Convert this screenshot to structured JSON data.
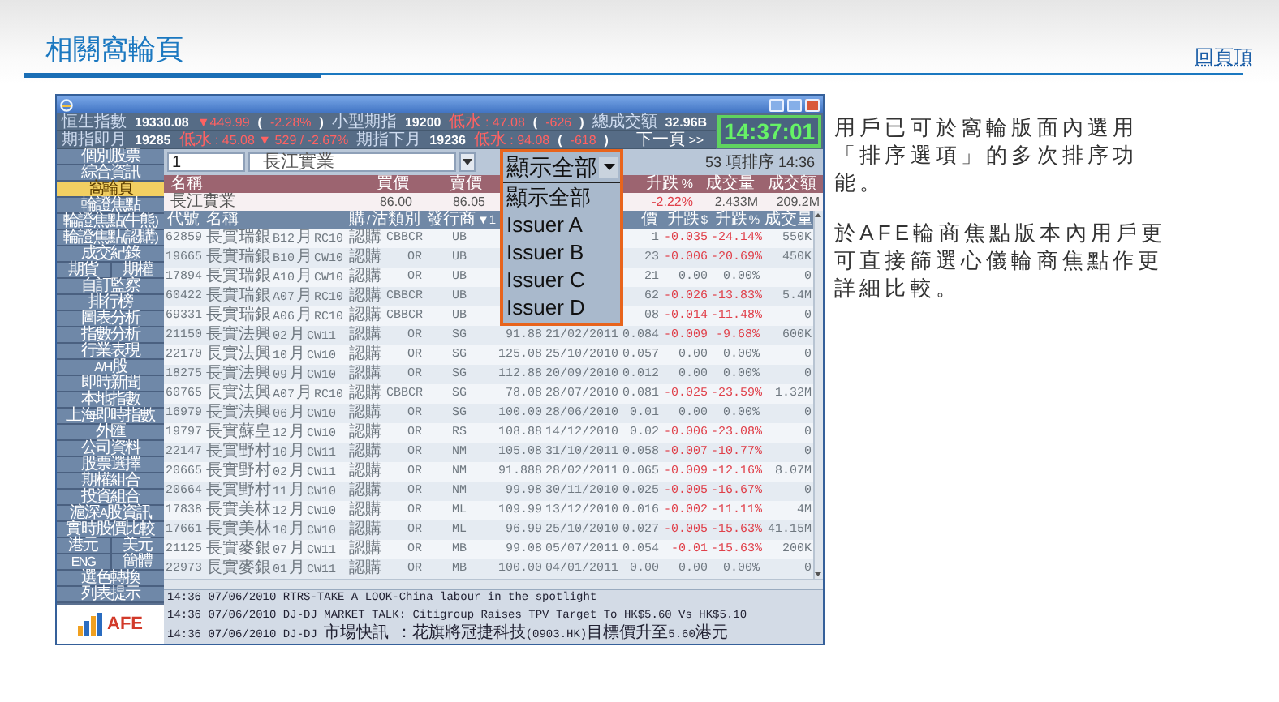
{
  "page": {
    "title": "相關窩輪頁",
    "top_link": "回頁頂"
  },
  "app": {
    "info_rows": [
      [
        {
          "text": "恒生指數",
          "kind": "label"
        },
        {
          "text": "19330.08",
          "kind": "value"
        },
        {
          "text": "▼449.99",
          "kind": "down"
        },
        {
          "text": "(",
          "kind": "value"
        },
        {
          "text": "-2.28%",
          "kind": "down"
        },
        {
          "text": ")",
          "kind": "value"
        },
        {
          "text": "小型期指",
          "kind": "label"
        },
        {
          "text": "19200",
          "kind": "value"
        },
        {
          "text": "低水 : 47.08",
          "kind": "down"
        },
        {
          "text": "(",
          "kind": "value"
        },
        {
          "text": "-626",
          "kind": "down"
        },
        {
          "text": ")",
          "kind": "value"
        },
        {
          "text": "總成交額",
          "kind": "label"
        },
        {
          "text": "32.96B",
          "kind": "value"
        }
      ],
      [
        {
          "text": "期指即月",
          "kind": "label"
        },
        {
          "text": "19285",
          "kind": "value"
        },
        {
          "text": "低水 : 45.08 ▼ 529 / -2.67%",
          "kind": "down"
        },
        {
          "text": "期指下月",
          "kind": "label"
        },
        {
          "text": "19236",
          "kind": "value"
        },
        {
          "text": "低水 : 94.08",
          "kind": "down"
        },
        {
          "text": "(",
          "kind": "value"
        },
        {
          "text": "-618",
          "kind": "down"
        },
        {
          "text": ")",
          "kind": "value"
        },
        {
          "text": "下一頁 >>",
          "kind": "link"
        }
      ]
    ],
    "clock": "14:37:01",
    "sidebar": [
      {
        "kind": "single",
        "label": "個別股票",
        "selected": false
      },
      {
        "kind": "single",
        "label": "綜合資訊",
        "selected": false
      },
      {
        "kind": "single",
        "label": "窩輪頁",
        "selected": true
      },
      {
        "kind": "single",
        "label": "輪證焦點",
        "selected": false
      },
      {
        "kind": "single",
        "label": "輪證焦點(牛熊)",
        "selected": false
      },
      {
        "kind": "single",
        "label": "輪證焦點(認購)",
        "selected": false
      },
      {
        "kind": "single",
        "label": "成交紀錄",
        "selected": false
      },
      {
        "kind": "pair",
        "items": [
          {
            "label": "期貨",
            "selected": false
          },
          {
            "label": "期權",
            "selected": false
          }
        ]
      },
      {
        "kind": "single",
        "label": "自訂監察",
        "selected": false
      },
      {
        "kind": "single",
        "label": "排行榜",
        "selected": false
      },
      {
        "kind": "single",
        "label": "圖表分析",
        "selected": false
      },
      {
        "kind": "single",
        "label": "指數分析",
        "selected": false
      },
      {
        "kind": "single",
        "label": "行業表現",
        "selected": false
      },
      {
        "kind": "single",
        "label": "A/H股",
        "selected": false
      },
      {
        "kind": "single",
        "label": "即時新聞",
        "selected": false
      },
      {
        "kind": "single",
        "label": "本地指數",
        "selected": false
      },
      {
        "kind": "single",
        "label": "上海即時指數",
        "selected": false
      },
      {
        "kind": "single",
        "label": "外匯",
        "selected": false
      },
      {
        "kind": "single",
        "label": "公司資料",
        "selected": false
      },
      {
        "kind": "single",
        "label": "股票選擇",
        "selected": false
      },
      {
        "kind": "single",
        "label": "期權組合",
        "selected": false
      },
      {
        "kind": "single",
        "label": "投資組合",
        "selected": false
      },
      {
        "kind": "single",
        "label": "滬深A股資訊",
        "selected": false
      },
      {
        "kind": "single",
        "label": "實時股價比較",
        "selected": false
      },
      {
        "kind": "pair",
        "items": [
          {
            "label": "港元",
            "selected": false
          },
          {
            "label": "美元",
            "selected": false
          }
        ]
      },
      {
        "kind": "pair",
        "items": [
          {
            "label": "ENG",
            "selected": false
          },
          {
            "label": "簡體",
            "selected": false
          }
        ]
      },
      {
        "kind": "single",
        "label": "選色轉換",
        "selected": false
      },
      {
        "kind": "single",
        "label": "列表提示",
        "selected": false
      }
    ],
    "logo": "AFE",
    "search": {
      "code": "1",
      "name": "長江實業"
    },
    "filter": {
      "value": "顯示全部",
      "options": [
        "顯示全部",
        "Issuer A",
        "Issuer B",
        "Issuer C",
        "Issuer D"
      ]
    },
    "sort_info": "53 項排序 14:36",
    "quote": {
      "columns": [
        "名稱",
        "買價",
        "賣價",
        "升跌%",
        "成交量",
        "成交額"
      ],
      "values": [
        {
          "text": "長江實業",
          "down": false
        },
        {
          "text": "86.00",
          "down": false
        },
        {
          "text": "86.05",
          "down": false
        },
        {
          "text": "-2.22%",
          "down": true
        },
        {
          "text": "2.433M",
          "down": false
        },
        {
          "text": "209.2M",
          "down": false
        }
      ]
    },
    "table": {
      "columns": [
        "代號",
        "名稱",
        "購/沽",
        "類別",
        "發行商▼1",
        "價",
        "升跌$",
        "升跌%",
        "成交量"
      ],
      "rows": [
        {
          "code": "62859",
          "name": "長實瑞銀B12月RC10",
          "cp": "認購",
          "category": "CBBCR",
          "issuer": "UB",
          "price": "1",
          "change": "-0.035",
          "change_pct": "-24.14%",
          "volume": "550K",
          "down": true
        },
        {
          "code": "19665",
          "name": "長實瑞銀B10月CW10",
          "cp": "認購",
          "category": "OR",
          "issuer": "UB",
          "price": "23",
          "change": "-0.006",
          "change_pct": "-20.69%",
          "volume": "450K",
          "down": true
        },
        {
          "code": "17894",
          "name": "長實瑞銀A10月CW10",
          "cp": "認購",
          "category": "OR",
          "issuer": "UB",
          "price": "21",
          "change": "0.00",
          "change_pct": "0.00%",
          "volume": "0",
          "down": false
        },
        {
          "code": "60422",
          "name": "長實瑞銀A07月RC10",
          "cp": "認購",
          "category": "CBBCR",
          "issuer": "UB",
          "price": "62",
          "change": "-0.026",
          "change_pct": "-13.83%",
          "volume": "5.4M",
          "down": true
        },
        {
          "code": "69331",
          "name": "長實瑞銀A06月RC10",
          "cp": "認購",
          "category": "CBBCR",
          "issuer": "UB",
          "price": "08",
          "change": "-0.014",
          "change_pct": "-11.48%",
          "volume": "0",
          "down": true
        },
        {
          "code": "21150",
          "name": "長實法興02月CW11",
          "cp": "認購",
          "category": "OR",
          "issuer": "SG",
          "strike": "91.88",
          "expiry": "21/02/2011",
          "price": "0.084",
          "change": "-0.009",
          "change_pct": "-9.68%",
          "volume": "600K",
          "down": true
        },
        {
          "code": "22170",
          "name": "長實法興10月CW10",
          "cp": "認購",
          "category": "OR",
          "issuer": "SG",
          "strike": "125.08",
          "expiry": "25/10/2010",
          "price": "0.057",
          "change": "0.00",
          "change_pct": "0.00%",
          "volume": "0",
          "down": false
        },
        {
          "code": "18275",
          "name": "長實法興09月CW10",
          "cp": "認購",
          "category": "OR",
          "issuer": "SG",
          "strike": "112.88",
          "expiry": "20/09/2010",
          "price": "0.012",
          "change": "0.00",
          "change_pct": "0.00%",
          "volume": "0",
          "down": false
        },
        {
          "code": "60765",
          "name": "長實法興A07月RC10",
          "cp": "認購",
          "category": "CBBCR",
          "issuer": "SG",
          "strike": "78.08",
          "expiry": "28/07/2010",
          "price": "0.081",
          "change": "-0.025",
          "change_pct": "-23.59%",
          "volume": "1.32M",
          "down": true
        },
        {
          "code": "16979",
          "name": "長實法興06月CW10",
          "cp": "認購",
          "category": "OR",
          "issuer": "SG",
          "strike": "100.00",
          "expiry": "28/06/2010",
          "price": "0.01",
          "change": "0.00",
          "change_pct": "0.00%",
          "volume": "0",
          "down": false
        },
        {
          "code": "19797",
          "name": "長實蘇皇12月CW10",
          "cp": "認購",
          "category": "OR",
          "issuer": "RS",
          "strike": "108.88",
          "expiry": "14/12/2010",
          "price": "0.02",
          "change": "-0.006",
          "change_pct": "-23.08%",
          "volume": "0",
          "down": true
        },
        {
          "code": "22147",
          "name": "長實野村10月CW11",
          "cp": "認購",
          "category": "OR",
          "issuer": "NM",
          "strike": "105.08",
          "expiry": "31/10/2011",
          "price": "0.058",
          "change": "-0.007",
          "change_pct": "-10.77%",
          "volume": "0",
          "down": true
        },
        {
          "code": "20665",
          "name": "長實野村02月CW11",
          "cp": "認購",
          "category": "OR",
          "issuer": "NM",
          "strike": "91.888",
          "expiry": "28/02/2011",
          "price": "0.065",
          "change": "-0.009",
          "change_pct": "-12.16%",
          "volume": "8.07M",
          "down": true
        },
        {
          "code": "20664",
          "name": "長實野村11月CW10",
          "cp": "認購",
          "category": "OR",
          "issuer": "NM",
          "strike": "99.98",
          "expiry": "30/11/2010",
          "price": "0.025",
          "change": "-0.005",
          "change_pct": "-16.67%",
          "volume": "0",
          "down": true
        },
        {
          "code": "17838",
          "name": "長實美林12月CW10",
          "cp": "認購",
          "category": "OR",
          "issuer": "ML",
          "strike": "109.99",
          "expiry": "13/12/2010",
          "price": "0.016",
          "change": "-0.002",
          "change_pct": "-11.11%",
          "volume": "4M",
          "down": true
        },
        {
          "code": "17661",
          "name": "長實美林10月CW10",
          "cp": "認購",
          "category": "OR",
          "issuer": "ML",
          "strike": "96.99",
          "expiry": "25/10/2010",
          "price": "0.027",
          "change": "-0.005",
          "change_pct": "-15.63%",
          "volume": "41.15M",
          "down": true
        },
        {
          "code": "21125",
          "name": "長實麥銀07月CW11",
          "cp": "認購",
          "category": "OR",
          "issuer": "MB",
          "strike": "99.08",
          "expiry": "05/07/2011",
          "price": "0.054",
          "change": "-0.01",
          "change_pct": "-15.63%",
          "volume": "200K",
          "down": true
        },
        {
          "code": "22973",
          "name": "長實麥銀01月CW11",
          "cp": "認購",
          "category": "OR",
          "issuer": "MB",
          "strike": "100.00",
          "expiry": "04/01/2011",
          "price": "0.00",
          "change": "0.00",
          "change_pct": "0.00%",
          "volume": "0",
          "down": false
        }
      ]
    },
    "news": [
      "14:36 07/06/2010 RTRS-TAKE A LOOK-China labour in the spotlight",
      "14:36 07/06/2010 DJ-DJ MARKET TALK: Citigroup Raises TPV Target To HK$5.60 Vs HK$5.10",
      "14:36 07/06/2010 DJ-DJ 市場快訊 ：花旗將冠捷科技(0903.HK)目標價升至5.60港元"
    ]
  },
  "description": [
    "用戶已可於窩輪版面內選用「排序選項」的多次排序功能。",
    "於AFE輪商焦點版本內用戶更可直接篩選心儀輪商焦點作更詳細比較。"
  ]
}
